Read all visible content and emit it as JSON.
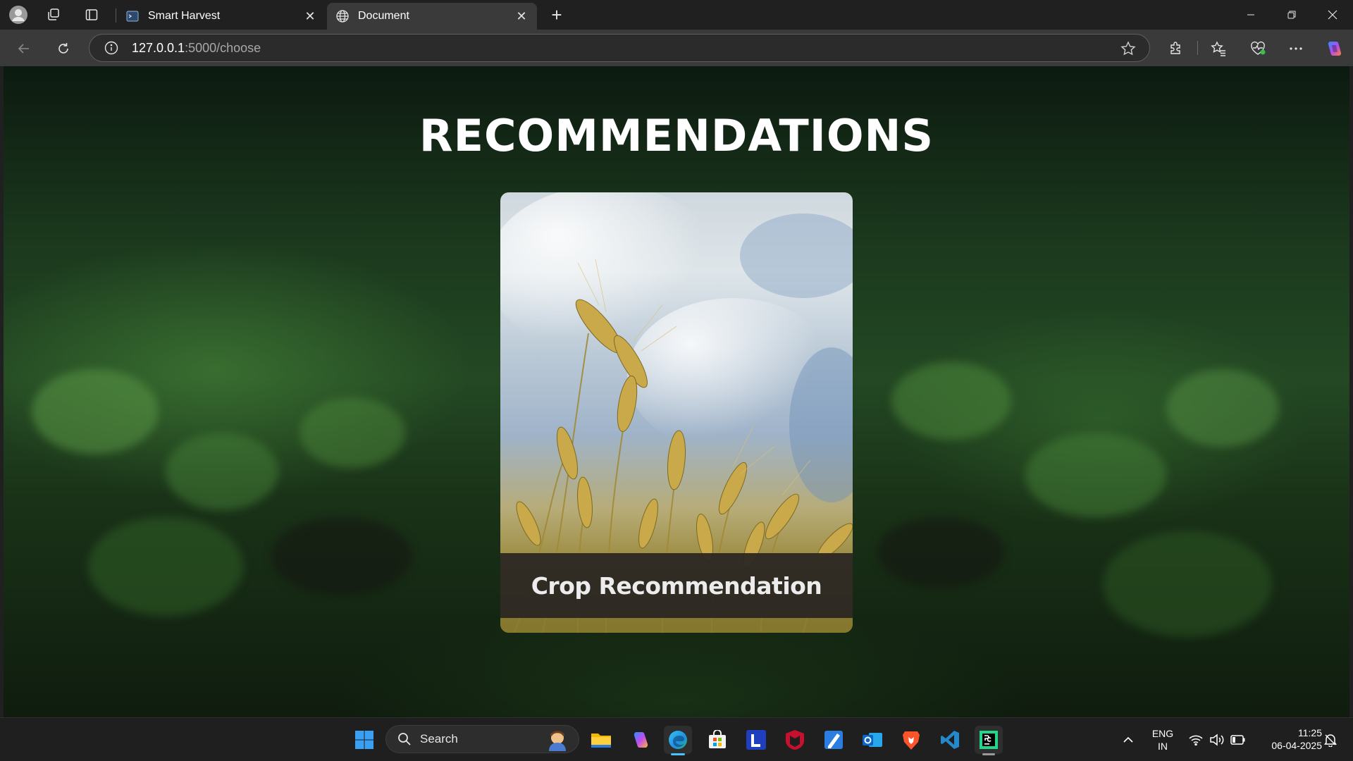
{
  "browser": {
    "tabs": [
      {
        "title": "Smart Harvest",
        "favicon": "app-icon"
      },
      {
        "title": "Document",
        "favicon": "globe-icon",
        "active": true
      }
    ],
    "address": {
      "host": "127.0.0.1",
      "path": ":5000/choose"
    }
  },
  "page": {
    "title": "RECOMMENDATIONS",
    "cards": [
      {
        "label": "Crop Recommendation",
        "image": "wheat-field-image"
      }
    ]
  },
  "taskbar": {
    "search_placeholder": "Search",
    "apps": [
      "start-icon",
      "file-explorer-icon",
      "copilot-icon",
      "edge-icon",
      "store-icon",
      "l-app-icon",
      "mcafee-icon",
      "pen-app-icon",
      "outlook-icon",
      "brave-icon",
      "vscode-icon",
      "pycharm-icon"
    ],
    "lang_top": "ENG",
    "lang_bottom": "IN",
    "time": "11:25",
    "date": "06-04-2025"
  },
  "colors": {
    "accent": "#4cc2ff",
    "chrome": "#202020",
    "toolbar": "#3a3a3a",
    "card_label_bg": "#2b2724"
  }
}
